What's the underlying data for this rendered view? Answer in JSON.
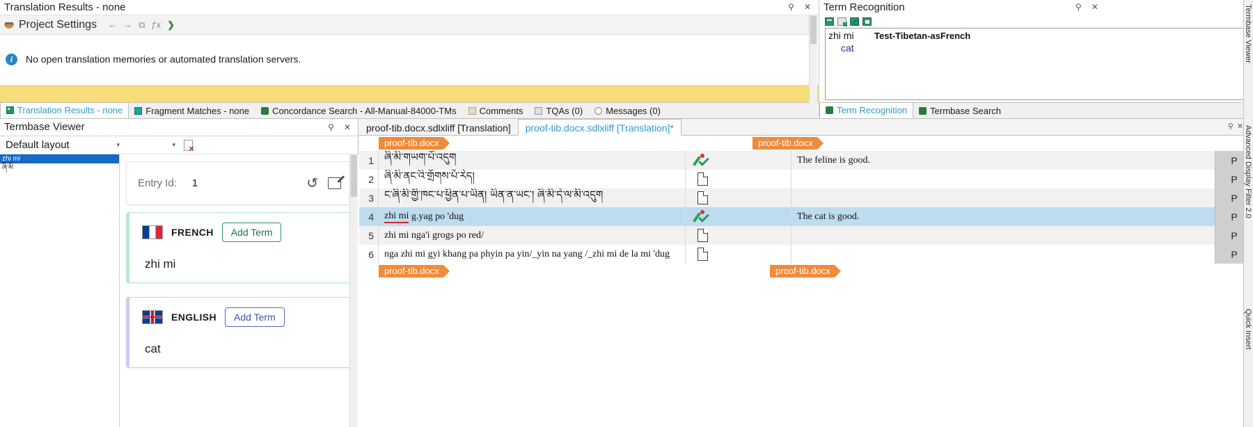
{
  "translation_results": {
    "title": "Translation Results - none",
    "pin_icon": "pin-icon",
    "close_icon": "close-icon",
    "toolbar": {
      "project_icon": "project-settings-icon",
      "project_label": "Project Settings",
      "back_icon": "←",
      "forward_icon": "→",
      "apply_icon": "⧉",
      "fx_icon": "ƒx",
      "next_icon": "❯"
    },
    "message": "No open translation memories or automated translation servers."
  },
  "bottom_tabs_left": [
    {
      "label": "Translation Results - none",
      "icon": "translation-results-icon",
      "active": true
    },
    {
      "label": "Fragment Matches - none",
      "icon": "fragment-matches-icon",
      "active": false
    },
    {
      "label": "Concordance Search - All-Manual-84000-TMs",
      "icon": "concordance-search-icon",
      "active": false
    },
    {
      "label": "Comments",
      "icon": "comments-icon",
      "active": false
    },
    {
      "label": "TQAs (0)",
      "icon": "tqa-icon",
      "active": false
    },
    {
      "label": "Messages (0)",
      "icon": "messages-icon",
      "active": false
    }
  ],
  "term_recognition": {
    "title": "Term Recognition",
    "pin_icon": "pin-icon",
    "close_icon": "close-icon",
    "toolbar_icons": [
      "termbase-settings-icon",
      "add-new-term-icon",
      "quick-add-term-icon",
      "view-term-details-icon"
    ],
    "entry": {
      "source": "zhi mi",
      "termbase": "Test-Tibetan-asFrench",
      "translation": "cat"
    },
    "tabs": [
      {
        "label": "Term Recognition",
        "icon": "term-recognition-icon",
        "active": true
      },
      {
        "label": "Termbase Search",
        "icon": "termbase-search-icon",
        "active": false
      }
    ]
  },
  "termbase_viewer": {
    "title": "Termbase Viewer",
    "pin_icon": "pin-icon",
    "close_icon": "close-icon",
    "layout_select": "Default layout",
    "layout_caret": "▾",
    "second_select": "",
    "second_caret": "▾",
    "delete_icon": "delete-entry-icon",
    "entries": [
      {
        "label": "zhi mi",
        "selected": true
      },
      {
        "label": "ཞི་མི",
        "selected": false
      }
    ],
    "entry_card": {
      "label": "Entry Id:",
      "value": "1",
      "history_icon": "history-icon",
      "edit_icon": "edit-icon"
    },
    "languages": [
      {
        "flag": "flag-france-icon",
        "name": "FRENCH",
        "add_button": "Add Term",
        "term": "zhi mi"
      },
      {
        "flag": "flag-uk-icon",
        "name": "ENGLISH",
        "add_button": "Add Term",
        "term": "cat"
      }
    ]
  },
  "editor": {
    "tabs": [
      {
        "label": "proof-tib.docx.sdlxliff [Translation]",
        "active": false
      },
      {
        "label": "proof-tib.docx.sdlxliff [Translation]*",
        "active": true
      }
    ],
    "source_doc_tag": "proof-tib.docx",
    "target_doc_tag": "proof-tib.docx",
    "footer_source_tag": "proof-tib.docx",
    "footer_target_tag": "proof-tib.docx",
    "rows": [
      {
        "num": "1",
        "source": "ཞི་མི་གཡག་པོ་འདུག",
        "source_script": "tibetan",
        "status_icon": "edited-confirmed-icon",
        "target": "The feline is good.",
        "state": "P",
        "selected": false,
        "shaded": true
      },
      {
        "num": "2",
        "source": "ཞི་མི་ནང་འི་གྲོགས་པོ་རེད།",
        "source_script": "tibetan",
        "status_icon": "not-translated-icon",
        "target": "",
        "state": "P",
        "selected": false,
        "shaded": false
      },
      {
        "num": "3",
        "source": "ང་ཞི་མི་གྱི་ཁང་པ་ཕྱིན་པ་ཡིན། ཡིན་ན་ཡང་། ཞི་མི་དེ་ལ་མི་འདུག",
        "source_script": "tibetan",
        "status_icon": "not-translated-icon",
        "target": "",
        "state": "P",
        "selected": false,
        "shaded": true
      },
      {
        "num": "4",
        "source": "zhi mi g.yag po 'dug",
        "source_script": "latin",
        "misspelled_prefix": "zhi mi",
        "status_icon": "edited-confirmed-icon",
        "target": "The cat is good.",
        "state": "P",
        "selected": true,
        "shaded": false
      },
      {
        "num": "5",
        "source": "zhi mi nga'i grogs po red/",
        "source_script": "latin",
        "status_icon": "not-translated-icon",
        "target": "",
        "state": "P",
        "selected": false,
        "shaded": true
      },
      {
        "num": "6",
        "source": "nga zhi mi gyi khang pa phyin pa yin/_yin na yang /_zhi mi de la mi 'dug",
        "source_script": "latin",
        "status_icon": "not-translated-icon",
        "target": "",
        "state": "P",
        "selected": false,
        "shaded": false
      }
    ]
  },
  "right_rail": {
    "labels": [
      "Termbase Viewer",
      "Advanced Display Filter 2.0",
      "Quick Insert"
    ]
  }
}
